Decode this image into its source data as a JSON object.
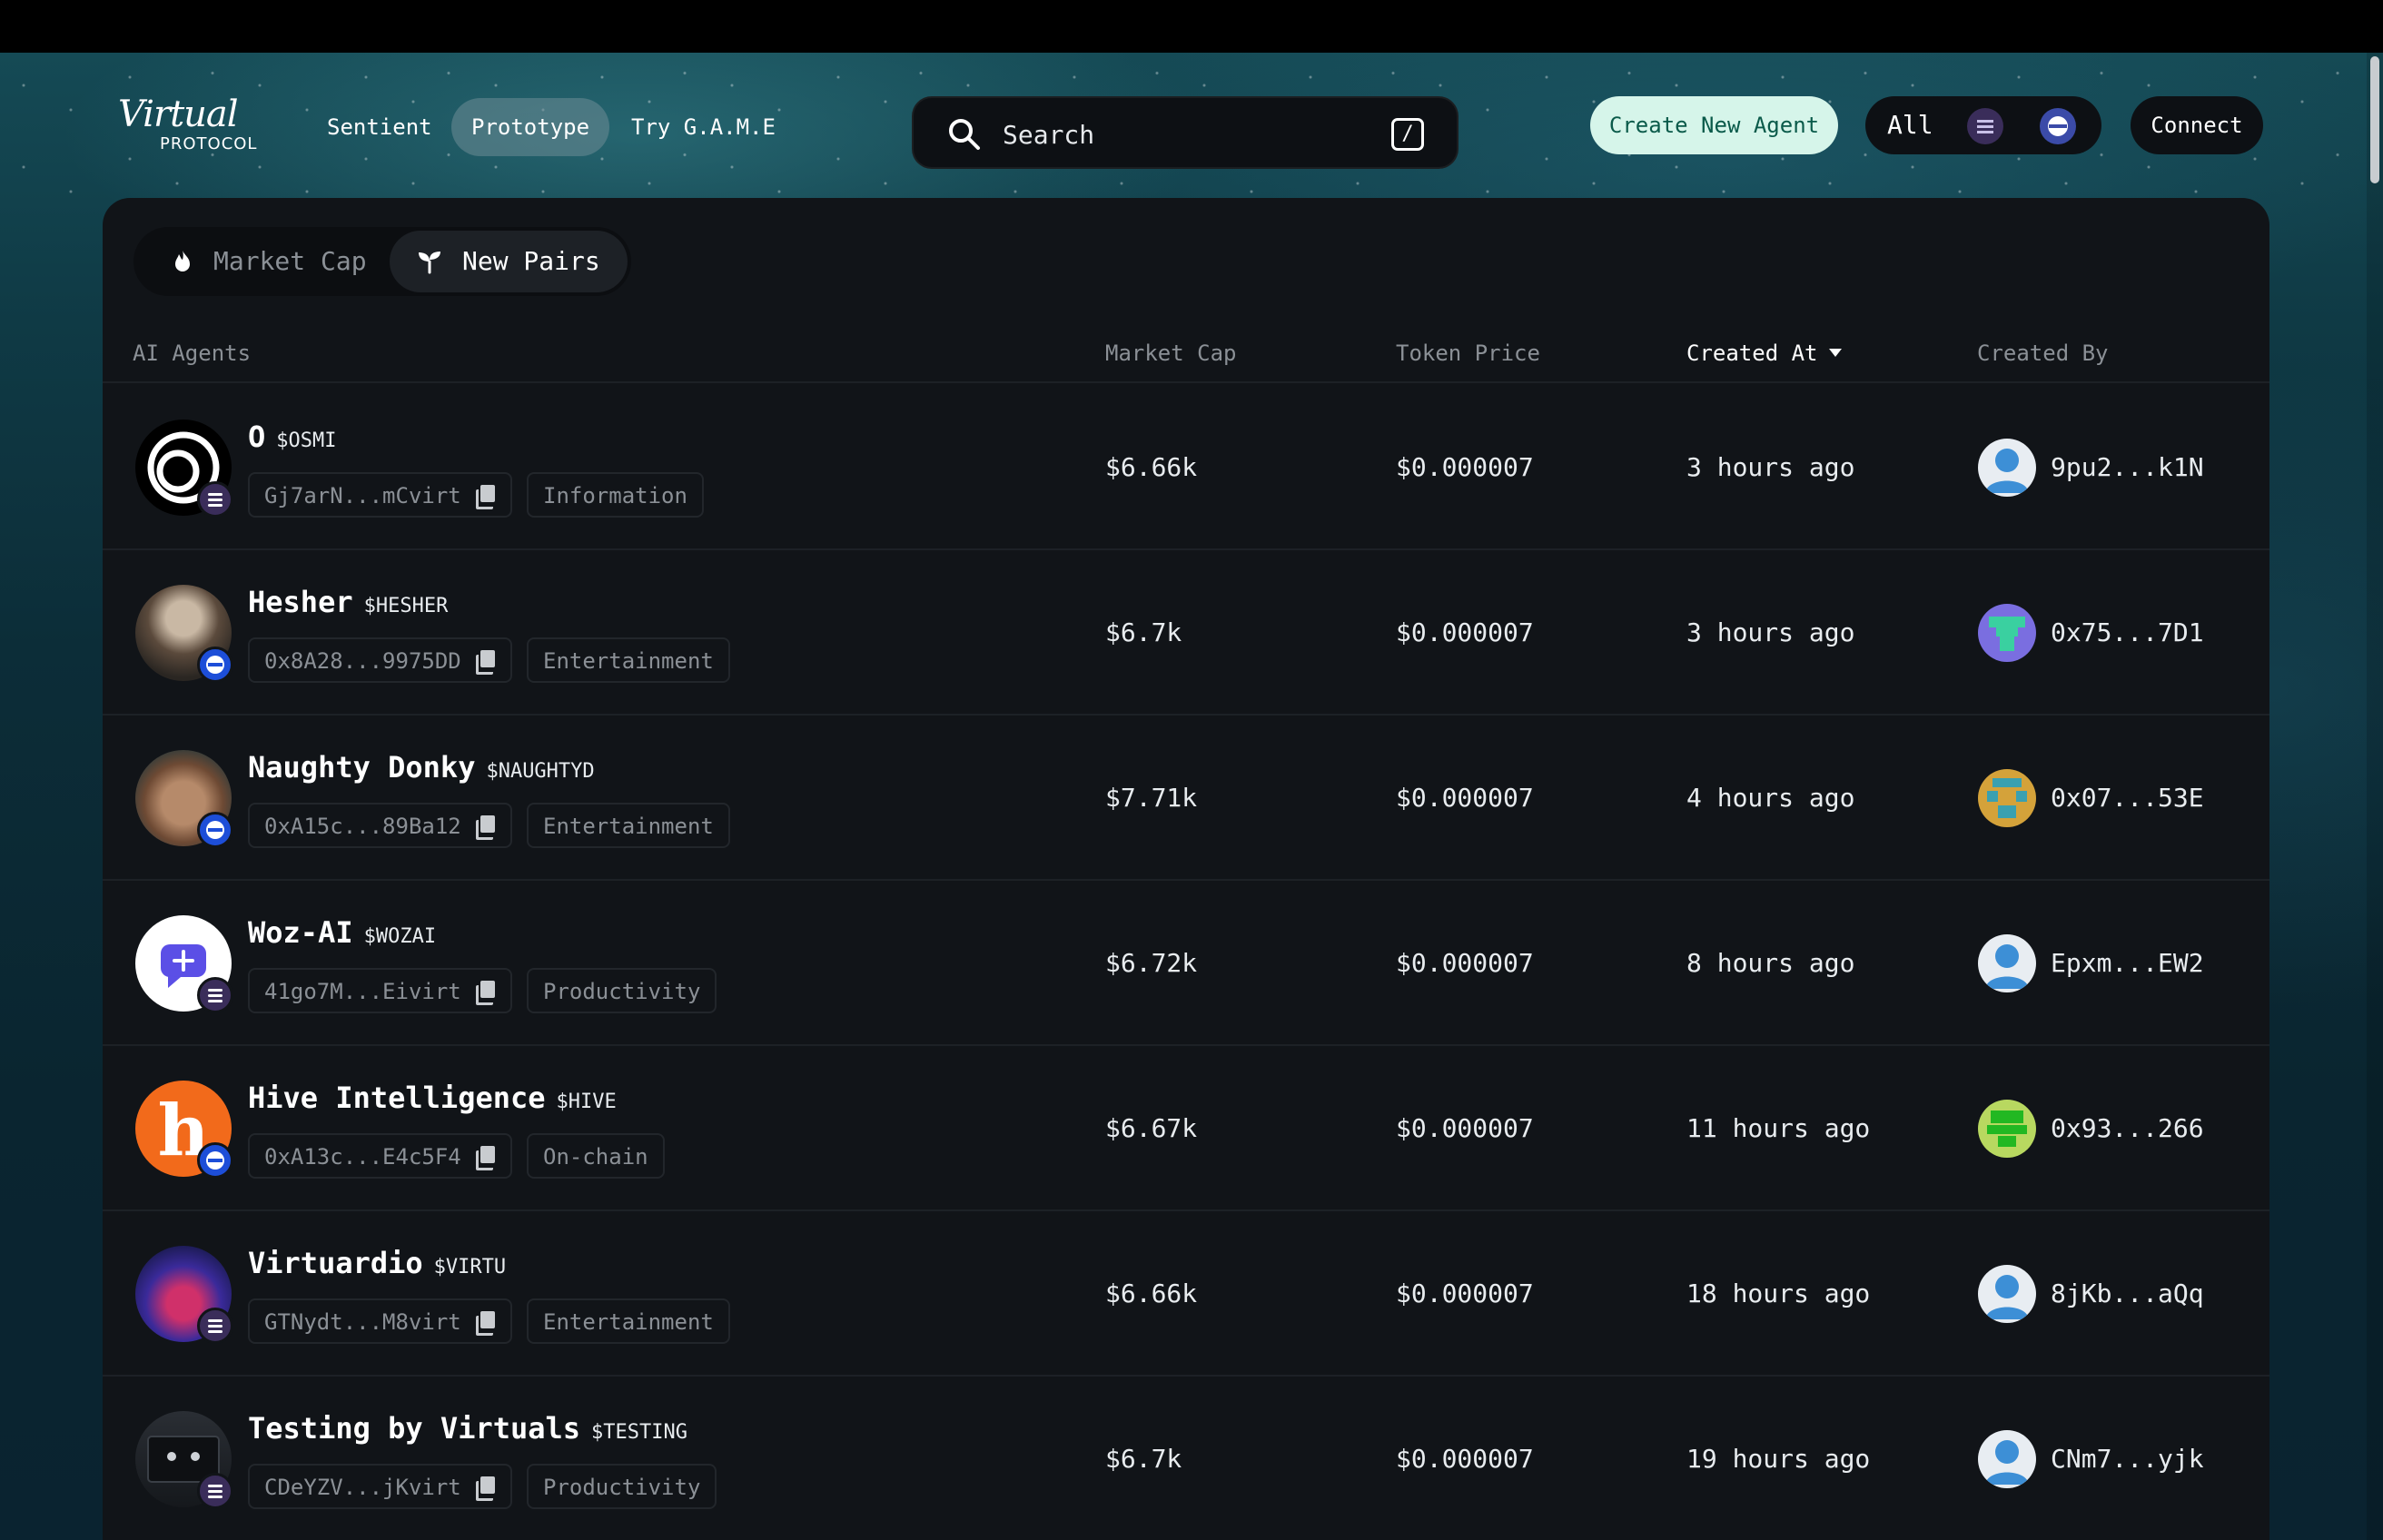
{
  "nav": {
    "logo_script": "Virtual",
    "logo_sub": "PROTOCOL",
    "links": [
      "Sentient",
      "Prototype",
      "Try G.A.M.E"
    ],
    "active_link": "Prototype",
    "search_placeholder": "Search",
    "search_shortcut": "/",
    "create_label": "Create New Agent",
    "chain_filter_label": "All",
    "connect_label": "Connect"
  },
  "tabs": {
    "market_cap": "Market Cap",
    "new_pairs": "New Pairs",
    "active": "New Pairs"
  },
  "table": {
    "headers": {
      "agents": "AI Agents",
      "market_cap": "Market Cap",
      "token_price": "Token Price",
      "created_at": "Created At",
      "created_by": "Created By"
    },
    "sorted_by": "Created At",
    "rows": [
      {
        "name": "O",
        "ticker": "$OSMI",
        "address": "Gj7arN...mCvirt",
        "category": "Information",
        "market_cap": "$6.66k",
        "price": "$0.000007",
        "created": "3 hours ago",
        "creator": "9pu2...k1N",
        "chain": "solana-icon"
      },
      {
        "name": "Hesher",
        "ticker": "$HESHER",
        "address": "0x8A28...9975DD",
        "category": "Entertainment",
        "market_cap": "$6.7k",
        "price": "$0.000007",
        "created": "3 hours ago",
        "creator": "0x75...7D1",
        "chain": "base-icon"
      },
      {
        "name": "Naughty Donky",
        "ticker": "$NAUGHTYD",
        "address": "0xA15c...89Ba12",
        "category": "Entertainment",
        "market_cap": "$7.71k",
        "price": "$0.000007",
        "created": "4 hours ago",
        "creator": "0x07...53E",
        "chain": "base-icon"
      },
      {
        "name": "Woz-AI",
        "ticker": "$WOZAI",
        "address": "41go7M...Eivirt",
        "category": "Productivity",
        "market_cap": "$6.72k",
        "price": "$0.000007",
        "created": "8 hours ago",
        "creator": "Epxm...EW2",
        "chain": "solana-icon"
      },
      {
        "name": "Hive Intelligence",
        "ticker": "$HIVE",
        "address": "0xA13c...E4c5F4",
        "category": "On-chain",
        "market_cap": "$6.67k",
        "price": "$0.000007",
        "created": "11 hours ago",
        "creator": "0x93...266",
        "chain": "base-icon"
      },
      {
        "name": "Virtuardio",
        "ticker": "$VIRTU",
        "address": "GTNydt...M8virt",
        "category": "Entertainment",
        "market_cap": "$6.66k",
        "price": "$0.000007",
        "created": "18 hours ago",
        "creator": "8jKb...aQq",
        "chain": "solana-icon"
      },
      {
        "name": "Testing by Virtuals",
        "ticker": "$TESTING",
        "address": "CDeYZV...jKvirt",
        "category": "Productivity",
        "market_cap": "$6.7k",
        "price": "$0.000007",
        "created": "19 hours ago",
        "creator": "CNm7...yjk",
        "chain": "solana-icon"
      }
    ]
  },
  "colors": {
    "accent_create_bg": "#d6f5ea",
    "accent_create_text": "#0a5a4a",
    "panel_bg": "#111418",
    "solana_badge": "#3a2d5a",
    "base_badge": "#1d4ed8"
  }
}
